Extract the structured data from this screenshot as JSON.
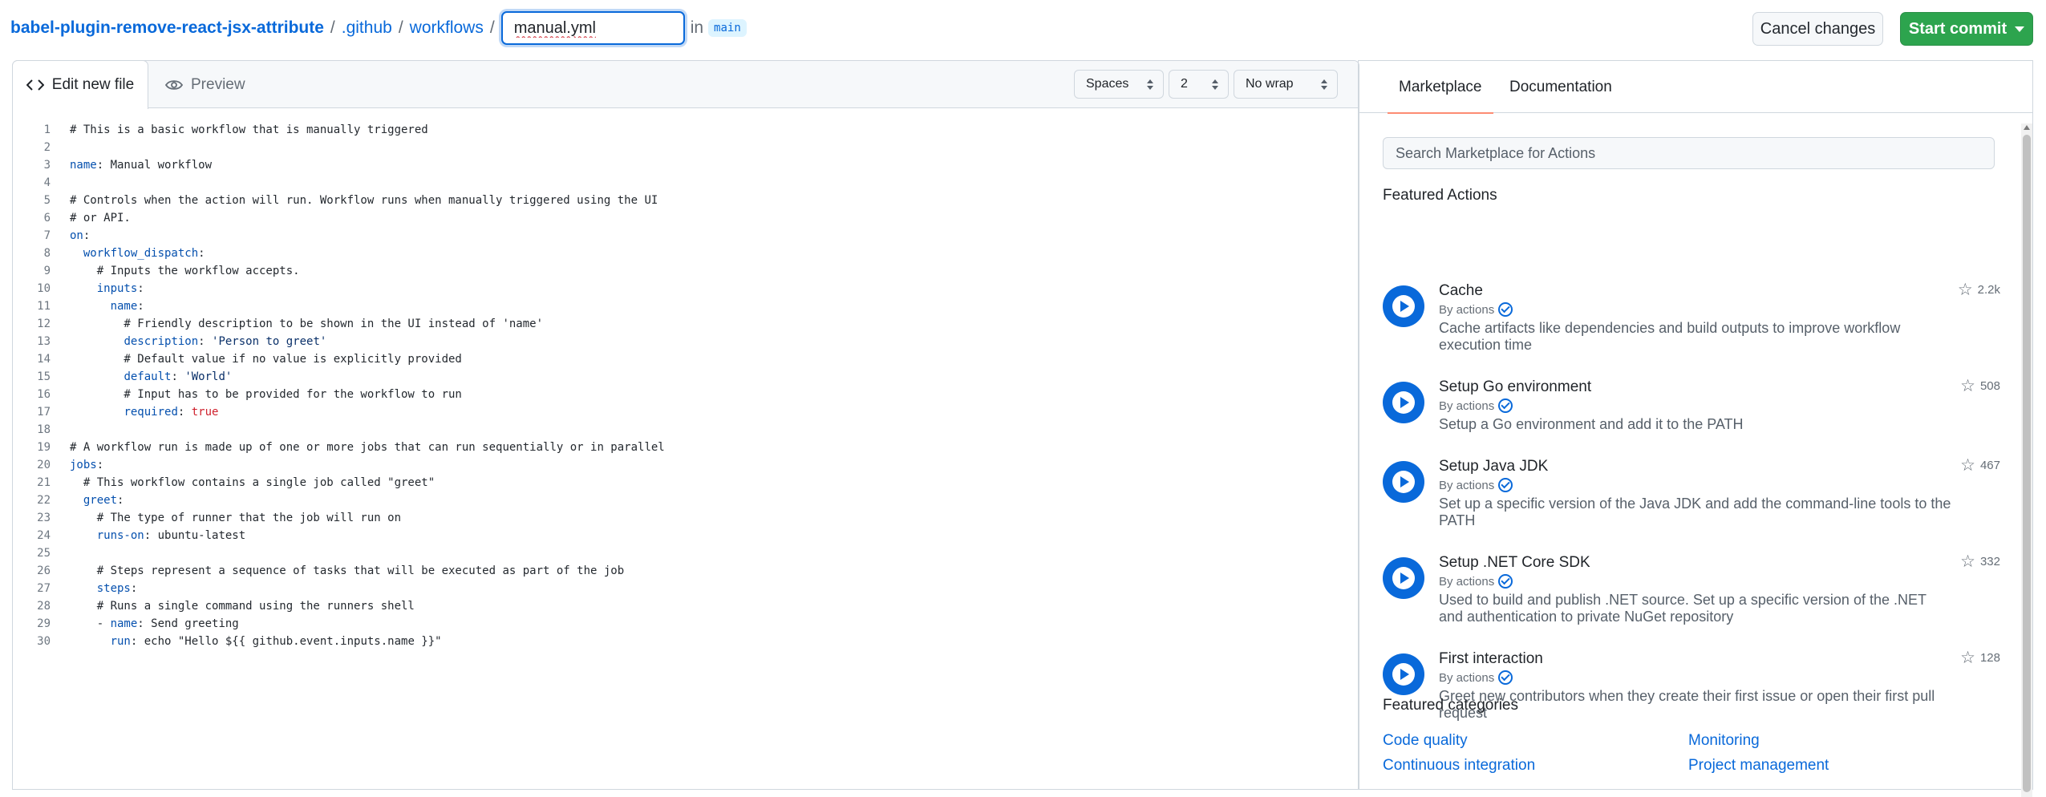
{
  "breadcrumb": {
    "repo": "babel-plugin-remove-react-jsx-attribute",
    "sep": "/",
    "folder1": ".github",
    "folder2": "workflows",
    "filename": "manual.yml",
    "in_label": "in",
    "branch": "main"
  },
  "header_buttons": {
    "cancel": "Cancel changes",
    "commit": "Start commit"
  },
  "editor": {
    "tab_edit": "Edit new file",
    "tab_preview": "Preview",
    "indent_mode": "Spaces",
    "indent_size": "2",
    "wrap_mode": "No wrap",
    "lines": [
      "# This is a basic workflow that is manually triggered",
      "",
      "name: Manual workflow",
      "",
      "# Controls when the action will run. Workflow runs when manually triggered using the UI",
      "# or API.",
      "on:",
      "  workflow_dispatch:",
      "    # Inputs the workflow accepts.",
      "    inputs:",
      "      name:",
      "        # Friendly description to be shown in the UI instead of 'name'",
      "        description: 'Person to greet'",
      "        # Default value if no value is explicitly provided",
      "        default: 'World'",
      "        # Input has to be provided for the workflow to run",
      "        required: true",
      "",
      "# A workflow run is made up of one or more jobs that can run sequentially or in parallel",
      "jobs:",
      "  # This workflow contains a single job called \"greet\"",
      "  greet:",
      "    # The type of runner that the job will run on",
      "    runs-on: ubuntu-latest",
      "",
      "    # Steps represent a sequence of tasks that will be executed as part of the job",
      "    steps:",
      "    # Runs a single command using the runners shell",
      "    - name: Send greeting",
      "      run: echo \"Hello ${{ github.event.inputs.name }}\""
    ]
  },
  "marketplace": {
    "tab_marketplace": "Marketplace",
    "tab_documentation": "Documentation",
    "search_placeholder": "Search Marketplace for Actions",
    "featured_actions_title": "Featured Actions",
    "actions": [
      {
        "name": "Cache",
        "by": "By actions",
        "stars": "2.2k",
        "desc": "Cache artifacts like dependencies and build outputs to improve workflow execution time"
      },
      {
        "name": "Setup Go environment",
        "by": "By actions",
        "stars": "508",
        "desc": "Setup a Go environment and add it to the PATH"
      },
      {
        "name": "Setup Java JDK",
        "by": "By actions",
        "stars": "467",
        "desc": "Set up a specific version of the Java JDK and add the command-line tools to the PATH"
      },
      {
        "name": "Setup .NET Core SDK",
        "by": "By actions",
        "stars": "332",
        "desc": "Used to build and publish .NET source. Set up a specific version of the .NET and authentication to private NuGet repository"
      },
      {
        "name": "First interaction",
        "by": "By actions",
        "stars": "128",
        "desc": "Greet new contributors when they create their first issue or open their first pull request"
      }
    ],
    "featured_categories_title": "Featured categories",
    "categories": [
      "Code quality",
      "Monitoring",
      "Continuous integration",
      "Project management"
    ]
  },
  "colors": {
    "accent": "#0969da",
    "commit_green": "#2da44e",
    "tab_underline": "#fd8c73"
  }
}
